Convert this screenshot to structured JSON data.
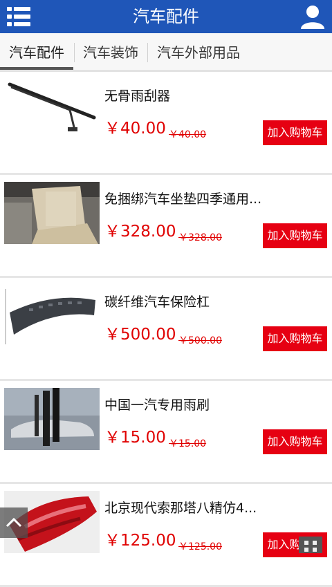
{
  "header": {
    "title": "汽车配件",
    "menu_icon": "menu-icon",
    "user_icon": "user-icon",
    "brand_color": "#1f56b8"
  },
  "tabs": [
    {
      "label": "汽车配件",
      "active": true
    },
    {
      "label": "汽车装饰",
      "active": false
    },
    {
      "label": "汽车外部用品",
      "active": false
    }
  ],
  "products": [
    {
      "name": "无骨雨刮器",
      "price": "￥40.00",
      "old_price": "￥40.00",
      "cart_label": "加入购物车",
      "image": "wiper-blade"
    },
    {
      "name": "免捆绑汽车坐垫四季通用...",
      "price": "￥328.00",
      "old_price": "￥328.00",
      "cart_label": "加入购物车",
      "image": "seat-cushion"
    },
    {
      "name": "碳纤维汽车保险杠",
      "price": "￥500.00",
      "old_price": "￥500.00",
      "cart_label": "加入购物车",
      "image": "bumper"
    },
    {
      "name": "中国一汽专用雨刷",
      "price": "￥15.00",
      "old_price": "￥15.00",
      "cart_label": "加入购物车",
      "image": "rain-wiper"
    },
    {
      "name": "北京现代索那塔八精仿4...",
      "price": "￥125.00",
      "old_price": "￥125.00",
      "cart_label": "加入购物车",
      "image": "tail-light"
    }
  ],
  "colors": {
    "price": "#e00000",
    "cart_button": "#e60012"
  }
}
